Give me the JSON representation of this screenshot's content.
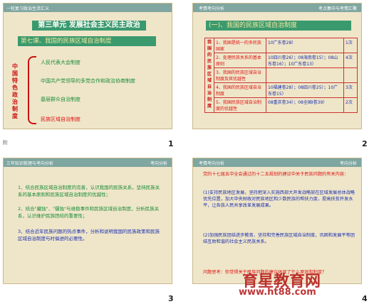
{
  "slide1": {
    "topbar": "一轮复习政治生活汇义",
    "title": "第三单元   发展社会主义民主政治",
    "subtitle": "第七课、我国的民族区域自治制度",
    "vertical_label": "中国特色政治制度",
    "items": [
      "人民代表大会制度",
      "中国共产党领导的多党合作和政治协商制度",
      "基层群众自治制度",
      "民族区域自治制度"
    ],
    "number": "1"
  },
  "slide2": {
    "topbar_left": "考情考向分析",
    "topbar_right": "考点集中与考情汇聚",
    "heading": "(一)、我国的民族区域自治制度",
    "vertical_label": "我国的民族区域自治制度",
    "rows": [
      {
        "a": "1、我国是统一的多民族国家",
        "b": "10广东卷28）",
        "c": "1次"
      },
      {
        "a": "2、处理民族关系的基本原则",
        "b": "10四川卷26）；08海南卷15）；08山东卷16）；10广东卷13）",
        "c": "4次"
      },
      {
        "a": "3、我国的民族区域自治制度及其优越性",
        "b": "",
        "c": ""
      },
      {
        "a": "4、我国的民族区域自治制度",
        "b": "10福建卷28）；08四川卷25）；10广东卷15）",
        "c": "3次"
      },
      {
        "a": "5、我国民族区域自治制度的优越性",
        "b": "08重庆卷34）；08全国I卷39）",
        "c": "2次"
      }
    ],
    "number": "2"
  },
  "slide3": {
    "topbar_left": "三年知识梳理与考向分析",
    "topbar_right": "考向分析",
    "items": [
      "1、结合民族区域自治制度的完善，认识我国的民族关系，坚持民族关系的基本原则和民族区域自治制度的优越性；",
      "2、结合\"藏独\"、\"疆独\"与维稳事件和民族区域自治制度，分析民族关系，认识维护民族团结的重要性；",
      "3、结合近年民族问题的热点事件，分析和说明我国的民族政策和民族区域自治制度与时俱进的必要性。"
    ],
    "number": "3"
  },
  "slide4": {
    "topbar_left": "考情考向分析",
    "topbar_right": "考向分析",
    "lead": "党的十七届五中全会通过的十二五规划的建议中关于民族问题的有关内容：",
    "para1": "(1)支持民族地区发展，坚持把深入实施西部大开发战略放在区域发展总体战略优先位置，加大中央财政对民族地区和少数民族的帮扶力度，提高扶贫开发水平，让各族人民共享改革发展成果。",
    "para2": "(2)加强民族团结进步教育，坚持和完善民族区域自治制度，巩固和发展平等团结互助和谐的社会主义民族关系。",
    "question": "问题思考：你觉得关于民族问题的建议体现了什么原则和制度？",
    "number": "4"
  },
  "watermark": {
    "text": "育星教育网",
    "url": "www.ht88.com"
  },
  "side_mark": "阶"
}
